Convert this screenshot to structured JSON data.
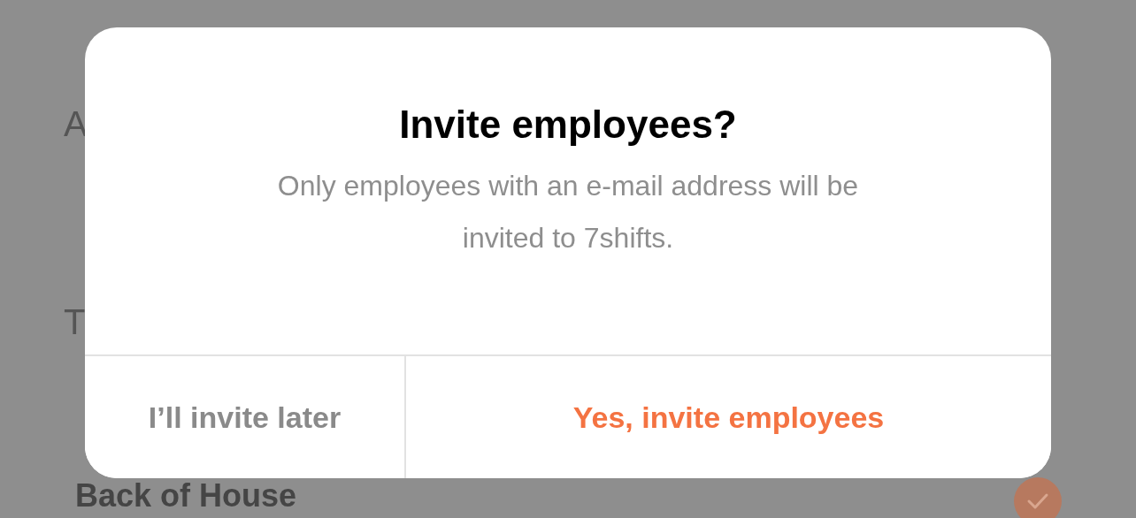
{
  "background": {
    "items": [
      {
        "label": "A",
        "kind": "heading"
      },
      {
        "label": "T",
        "kind": "heading"
      },
      {
        "label": "Back of House",
        "kind": "option",
        "checked": true
      }
    ]
  },
  "dialog": {
    "title": "Invite employees?",
    "message": "Only employees with an e-mail address will be invited to 7shifts.",
    "buttons": [
      {
        "label": "I’ll invite later",
        "kind": "secondary"
      },
      {
        "label": "Yes, invite employees",
        "kind": "primary"
      }
    ]
  }
}
